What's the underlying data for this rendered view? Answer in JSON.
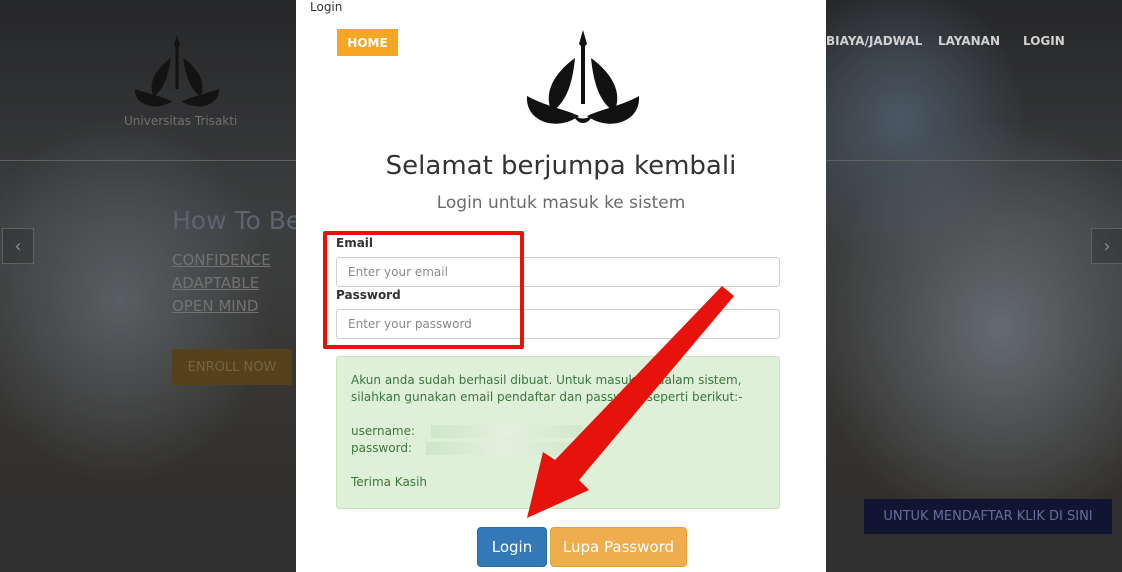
{
  "background": {
    "university_name": "Universitas Trisakti",
    "nav": {
      "biaya": "BIAYA/JADWAL",
      "layanan": "LAYANAN",
      "login": "LOGIN"
    },
    "hero": {
      "title": "How To Be",
      "lines": [
        "CONFIDENCE",
        "ADAPTABLE",
        "OPEN MIND"
      ],
      "enroll_label": "ENROLL NOW"
    },
    "prev_icon": "chevron-left-icon",
    "next_icon": "chevron-right-icon",
    "register_label": "UNTUK MENDAFTAR KLIK DI SINI"
  },
  "modal": {
    "window_title": "Login",
    "home_label": "HOME",
    "logo_icon": "trisakti-logo-icon",
    "heading": "Selamat berjumpa kembali",
    "subheading": "Login untuk masuk ke sistem",
    "email": {
      "label": "Email",
      "placeholder": "Enter your email",
      "value": ""
    },
    "password": {
      "label": "Password",
      "placeholder": "Enter your password",
      "value": ""
    },
    "alert": {
      "line1": "Akun anda sudah berhasil dibuat. Untuk masuk ke dalam sistem,",
      "line2": "silahkan gunakan email pendaftar dan password seperti berikut:-",
      "username_label": "username:",
      "password_label": "password:",
      "closing": "Terima Kasih"
    },
    "login_label": "Login",
    "forgot_label": "Lupa Password"
  },
  "colors": {
    "home": "#f5a623",
    "login_button": "#3379b7",
    "forgot_button": "#efad4e",
    "alert_bg": "#dff0d8",
    "annotation": "#e8120c"
  }
}
